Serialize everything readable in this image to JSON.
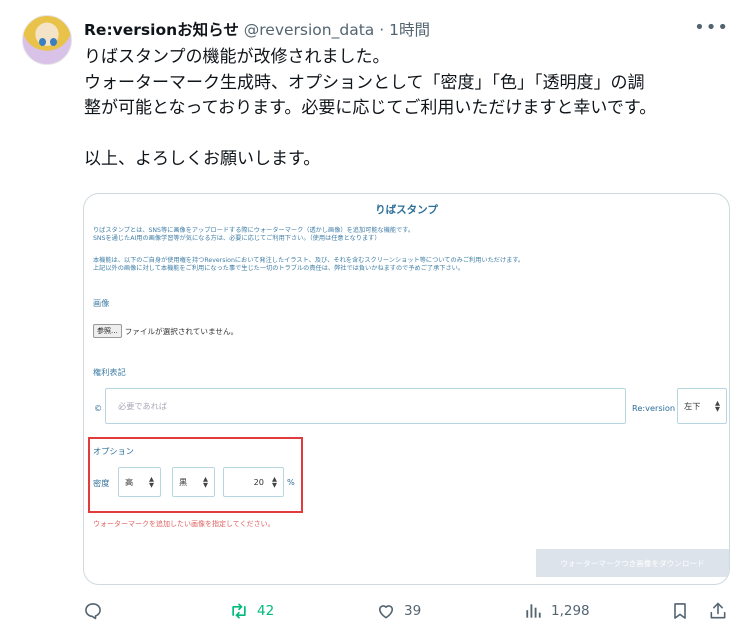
{
  "tweet": {
    "author_name": "Re:versionお知らせ",
    "handle": "@reversion_data",
    "separator": "·",
    "time": "1時間",
    "more_icon": "more-horizontal-icon",
    "lines": [
      "りばスタンプの機能が改修されました。",
      "ウォーターマーク生成時、オプションとして「密度」「色」「透明度」の調",
      "整が可能となっております。必要に応じてご利用いただけますと幸いです。",
      "",
      "以上、よろしくお願いします。"
    ]
  },
  "media": {
    "title": "りばスタンプ",
    "desc1": [
      "りばスタンプとは、SNS等に画像をアップロードする際にウォーターマーク（透かし画像）を追加可能な機能です。",
      "SNSを通じたAI用の画像学習等が気になる方は、必要に応じてご利用下さい。（使用は任意となります）"
    ],
    "desc2": [
      "本機能は、以下のご自身が使用権を持つReversionにおいて発注したイラスト、及び、それを含むスクリーンショット等についてのみご利用いただけます。",
      "上記以外の画像に対して本機能をご利用になった事で生じた一切のトラブルの責任は、弊社では負いかねますので予めご了承下さい。"
    ],
    "image_label": "画像",
    "browse_button": "参照...",
    "no_file_text": "ファイルが選択されていません。",
    "rights_label": "権利表記",
    "copyright_symbol": "©",
    "rights_placeholder": "必要であれば",
    "rights_suffix": "Re:version",
    "position_select": "左下",
    "options_label": "オプション",
    "density_label": "密度",
    "density_value": "高",
    "color_value": "黒",
    "opacity_value": "20",
    "percent": "%",
    "error_text": "ウォーターマークを追加したい画像を指定してください。",
    "download_button": "ウォーターマークつき画像をダウンロード",
    "highlight_color": "#e23b3b"
  },
  "actions": {
    "reply_icon": "reply-icon",
    "retweet_icon": "retweet-icon",
    "retweet_count": "42",
    "like_icon": "heart-icon",
    "like_count": "39",
    "views_icon": "views-chart-icon",
    "views_count": "1,298",
    "bookmark_icon": "bookmark-icon",
    "share_icon": "share-icon",
    "retweet_color": "#00ba7c"
  }
}
